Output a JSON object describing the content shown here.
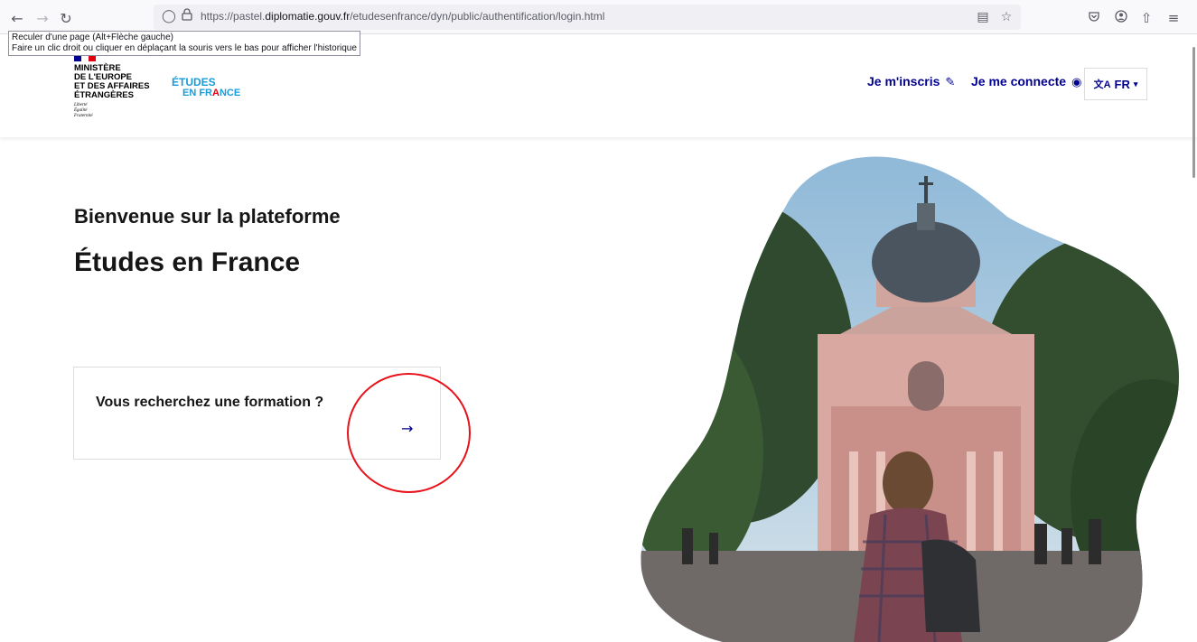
{
  "browser": {
    "url_prefix": "https://pastel.",
    "url_domain": "diplomatie.gouv.fr",
    "url_path": "/etudesenfrance/dyn/public/authentification/login.html",
    "tooltip_line1": "Reculer d'une page (Alt+Flèche gauche)",
    "tooltip_line2": "Faire un clic droit ou cliquer en déplaçant la souris vers le bas pour afficher l'historique"
  },
  "header": {
    "ministry_lines": [
      "MINISTÈRE",
      "DE L'EUROPE",
      "ET DES AFFAIRES",
      "ÉTRANGÈRES"
    ],
    "devise": [
      "Liberté",
      "Égalité",
      "Fraternité"
    ],
    "logo_line1": "ÉTUDES",
    "logo_line2a": "EN FR",
    "logo_line2b": "A",
    "logo_line2c": "NCE",
    "register_label": "Je m'inscris",
    "login_label": "Je me connecte",
    "lang_label": "FR"
  },
  "main": {
    "welcome": "Bienvenue sur la plateforme",
    "platform_name": "Études en France",
    "card_title": "Vous recherchez une formation ?"
  },
  "colors": {
    "primary": "#000091",
    "accent_red": "#e1000f",
    "logo_blue": "#1a9bd8",
    "annotation_red": "#e8121b"
  }
}
